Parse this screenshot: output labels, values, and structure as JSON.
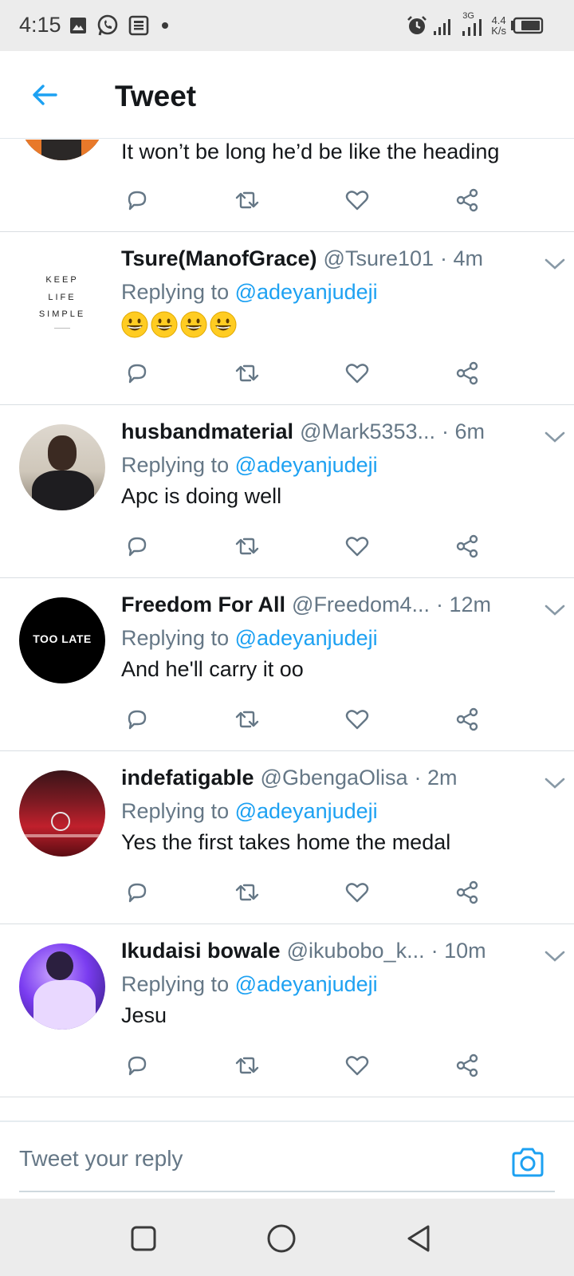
{
  "status_bar": {
    "time": "4:15",
    "network": "3G",
    "speed_value": "4.4",
    "speed_unit": "K/s",
    "icons": [
      "gallery-icon",
      "whatsapp-icon",
      "news-icon",
      "dot-icon",
      "alarm-icon",
      "signal-icon",
      "signal-3g-icon",
      "battery-icon"
    ]
  },
  "header": {
    "title": "Tweet",
    "back_icon": "arrow-left-icon"
  },
  "colors": {
    "accent": "#1da1f2",
    "text_primary": "#14171a",
    "text_secondary": "#657786"
  },
  "replying_label": "Replying to",
  "tweets": [
    {
      "partial": true,
      "text": "It won’t be long he’d be like the heading"
    },
    {
      "name": "Tsure(ManofGrace)",
      "handle": "@Tsure101",
      "time": "· 4m",
      "reply_to": "@adeyanjudeji",
      "text": "",
      "emoji": [
        "grinning-face",
        "grinning-face",
        "grinning-face",
        "grinning-face"
      ],
      "avatar_lines": [
        "KEEP",
        "LIFE",
        "SIMPLE"
      ]
    },
    {
      "name": "husbandmaterial",
      "handle": "@Mark5353...",
      "time": "· 6m",
      "reply_to": "@adeyanjudeji",
      "text": "Apc is doing well"
    },
    {
      "name": "Freedom For All",
      "handle": "@Freedom4...",
      "time": "· 12m",
      "reply_to": "@adeyanjudeji",
      "text": "And he'll carry it oo",
      "avatar_text": "TOO LATE"
    },
    {
      "name": "indefatigable",
      "handle": "@GbengaOlisa",
      "time": "· 2m",
      "reply_to": "@adeyanjudeji",
      "text": "Yes the first takes home the medal"
    },
    {
      "name": "Ikudaisi bowale",
      "handle": "@ikubobo_k...",
      "time": "· 10m",
      "reply_to": "@adeyanjudeji",
      "text": "Jesu"
    }
  ],
  "action_icons": [
    "reply-icon",
    "retweet-icon",
    "like-icon",
    "share-icon"
  ],
  "reply_bar": {
    "placeholder": "Tweet your reply",
    "camera_icon": "camera-icon"
  },
  "nav_bar": {
    "icons": [
      "recents-square-icon",
      "home-circle-icon",
      "back-triangle-icon"
    ]
  }
}
